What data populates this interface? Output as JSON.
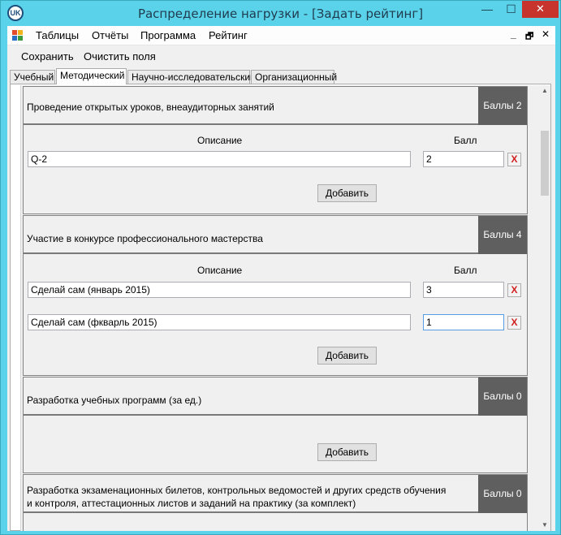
{
  "window": {
    "title": "Распределение нагрузки - [Задать рейтинг]",
    "icon_text": "UK",
    "controls": {
      "minimize": "—",
      "maximize": "☐",
      "close": "✕"
    }
  },
  "menu": {
    "items": [
      "Таблицы",
      "Отчёты",
      "Программа",
      "Рейтинг"
    ],
    "mdi": {
      "minimize": "_",
      "restore": "🗗",
      "close": "✕"
    }
  },
  "toolbar": {
    "save_label": "Сохранить",
    "clear_label": "Очистить поля"
  },
  "tabs": [
    {
      "label": "Учебный",
      "active": false
    },
    {
      "label": "Методический",
      "active": true
    },
    {
      "label": "Научно-исследовательский",
      "active": false
    },
    {
      "label": "Организационный",
      "active": false
    }
  ],
  "labels": {
    "description": "Описание",
    "score": "Балл",
    "add_button": "Добавить",
    "delete_button": "X"
  },
  "sections": [
    {
      "title": "Проведение открытых уроков, внеаудиторных занятий",
      "score": "Баллы 2",
      "rows": [
        {
          "description": "Q-2",
          "score": "2"
        }
      ]
    },
    {
      "title": "Участие в конкурсе профессионального мастерства",
      "score": "Баллы 4",
      "rows": [
        {
          "description": "Сделай сам (январь 2015)",
          "score": "3"
        },
        {
          "description": "Сделай сам (фкварль 2015)",
          "score": "1"
        }
      ]
    },
    {
      "title": "Разработка учебных программ (за ед.)",
      "score": "Баллы 0",
      "rows": []
    },
    {
      "title_line1": "Разработка  экзаменационных билетов, контрольных ведомостей и других средств обучения",
      "title_line2": "и контроля, аттестационных листов и заданий на практику (за комплект)",
      "score": "Баллы 0"
    }
  ],
  "colors": {
    "titlebar": "#5ad3ea",
    "section_score_bg": "#5f5f5f",
    "close_button": "#c7342d",
    "delete_x": "#d21f1f"
  }
}
